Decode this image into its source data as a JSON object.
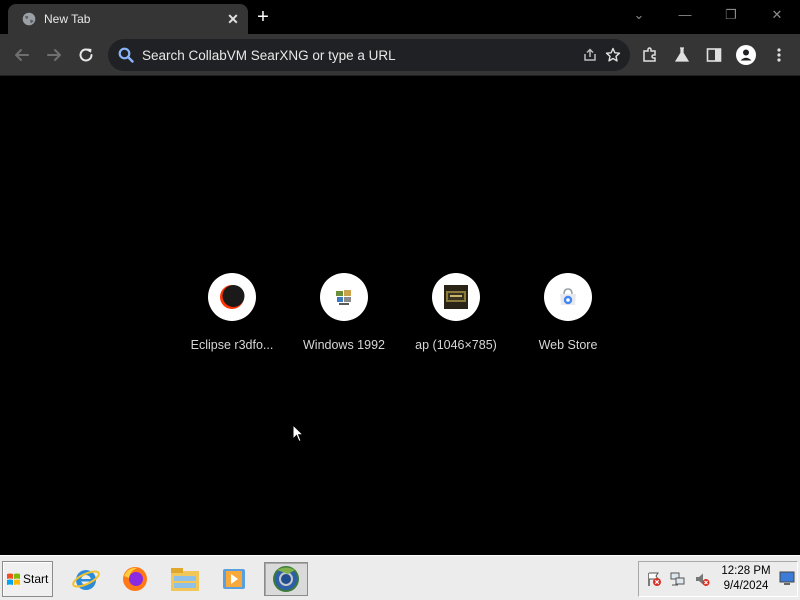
{
  "browser": {
    "tab": {
      "title": "New Tab",
      "close_glyph": "✕"
    },
    "new_tab_glyph": "+",
    "window_controls": {
      "dropdown": "⌄",
      "minimize": "—",
      "restore": "❐",
      "close": "✕"
    },
    "omnibox": {
      "placeholder": "Search CollabVM SearXNG or type a URL"
    },
    "icons": [
      "back-icon",
      "forward-icon",
      "reload-icon",
      "search-icon",
      "share-icon",
      "star-icon",
      "extensions-icon",
      "labs-icon",
      "side-panel-icon",
      "profile-icon",
      "menu-icon"
    ]
  },
  "shortcuts": [
    {
      "label": "Eclipse r3dfo...",
      "icon": "eclipse-icon"
    },
    {
      "label": "Windows 1992",
      "icon": "windows-1992-icon"
    },
    {
      "label": "ap (1046×785)",
      "icon": "ap-image-icon"
    },
    {
      "label": "Web Store",
      "icon": "web-store-icon"
    }
  ],
  "taskbar": {
    "start_label": "Start",
    "apps": [
      "internet-explorer-icon",
      "firefox-icon",
      "file-explorer-icon",
      "media-player-icon",
      "chrome-icon"
    ],
    "tray": [
      "action-center-icon",
      "network-icon",
      "volume-icon"
    ],
    "clock": {
      "time": "12:28 PM",
      "date": "9/4/2024"
    },
    "show_desktop_icon": "show-desktop-icon"
  },
  "colors": {
    "tab_bg": "#353535",
    "toolbar_bg": "#353535",
    "omnibox_bg": "#202124",
    "page_bg": "#000000",
    "taskbar_bg": "#ececec",
    "search_icon": "#8ab4f8"
  }
}
